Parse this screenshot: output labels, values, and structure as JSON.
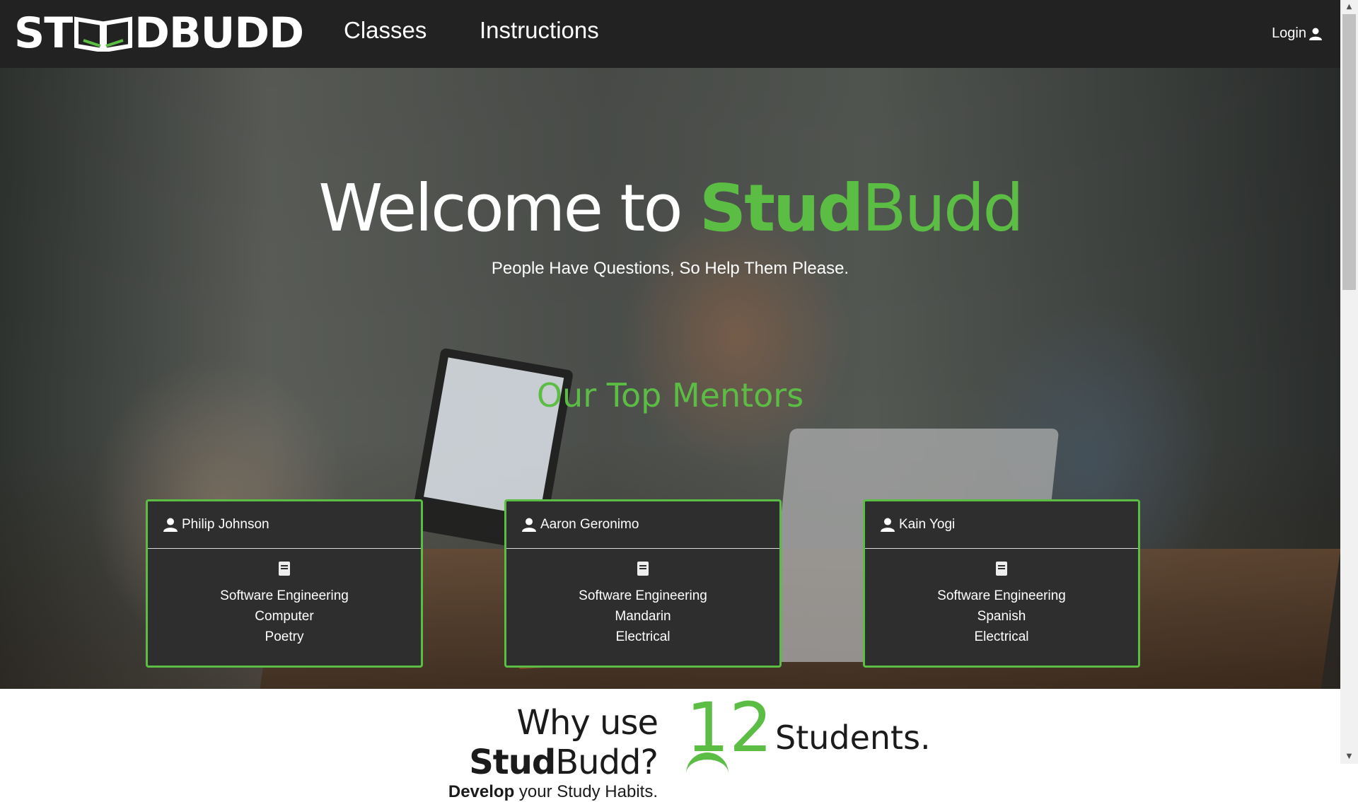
{
  "brand": {
    "logo_text_left": "ST",
    "logo_text_right": "DBUDD"
  },
  "nav": {
    "classes": "Classes",
    "instructions": "Instructions",
    "login": "Login"
  },
  "hero": {
    "title_white": "Welcome to ",
    "title_green_bold": "Stud",
    "title_green": "Budd",
    "subtitle": "People Have Questions, So Help Them Please.",
    "mentors_title": "Our Top Mentors"
  },
  "mentors": [
    {
      "name": "Philip Johnson",
      "subjects": [
        "Software Engineering",
        "Computer",
        "Poetry"
      ]
    },
    {
      "name": "Aaron Geronimo",
      "subjects": [
        "Software Engineering",
        "Mandarin",
        "Electrical"
      ]
    },
    {
      "name": "Kain Yogi",
      "subjects": [
        "Software Engineering",
        "Spanish",
        "Electrical"
      ]
    }
  ],
  "why": {
    "title_prefix": "Why use ",
    "title_bold": "Stud",
    "title_suffix": "Budd?",
    "sub_bold": "Develop",
    "sub_rest": " your Study Habits."
  },
  "stats": {
    "count": "12",
    "label": "Students."
  },
  "colors": {
    "accent": "#5cbd45",
    "navbar": "#222222",
    "card_bg": "#2e2e2e"
  },
  "icons": [
    "user-icon",
    "book-icon",
    "logo-book-icon"
  ]
}
